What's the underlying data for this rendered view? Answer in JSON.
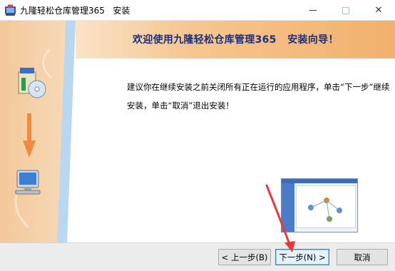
{
  "window": {
    "title": "九隆轻松仓库管理365   安装",
    "controls": {
      "minimize": "minimize",
      "maximize": "maximize",
      "close": "✕"
    }
  },
  "banner": {
    "title": "欢迎使用九隆轻松仓库管理365   安装向导！"
  },
  "content": {
    "message": "建议你在继续安装之前关闭所有正在运行的应用程序，单击“下一步”继续安装，单击“取消”退出安装！"
  },
  "buttons": {
    "prev": "< 上一步(B)",
    "next": "下一步(N) >",
    "cancel": "取消"
  },
  "colors": {
    "banner_text": "#1a2f80",
    "arrow_orange": "#f08a3c",
    "annotation_red": "#e8383a"
  },
  "icons": [
    "installer-app-icon",
    "install-box-icon",
    "down-arrow-icon",
    "computer-icon"
  ]
}
